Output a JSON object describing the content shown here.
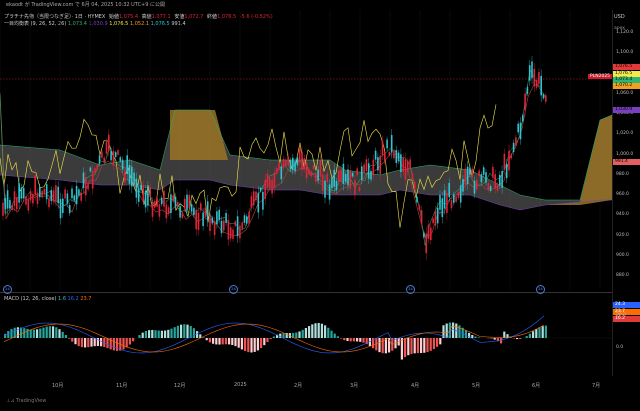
{
  "topbar": {
    "text": "ekaodt が TradingView.com で 6月 04, 2025 10:32 UTC+9 に公開"
  },
  "legend": {
    "symbol": "プラチナ先物（当限つなぎ足）· 1日 · HYMEX",
    "open_label": "始値",
    "open": "1,075.4",
    "high_label": "高値",
    "high": "1,077.1",
    "low_label": "安値",
    "low": "1,072.7",
    "close_label": "終値",
    "close": "1,076.5",
    "change": "-5.6 (-0.52%)",
    "ichimoku": "一目均衡表 (9, 26, 52, 26)",
    "ich_values": [
      "1,073.4",
      "1,030.9",
      "1,076.5",
      "1,052.1",
      "1,076.5",
      "991.4"
    ]
  },
  "price_axis": {
    "currency": "USD",
    "mode": "apex",
    "ticks": [
      "1,120.0",
      "1,100.0",
      "1,080.0",
      "1,060.0",
      "1,040.0",
      "1,020.0",
      "1,000.0",
      "980.0",
      "960.0",
      "940.0",
      "920.0",
      "900.0",
      "880.0"
    ],
    "labels": [
      {
        "text": "1,076.5",
        "color": "#e03a3a"
      },
      {
        "text": "1,076.5",
        "color": "#f4e84b"
      },
      {
        "text": "1,073.4",
        "color": "#2bb673"
      },
      {
        "text": "1,070.2",
        "color": "#f0a020"
      },
      {
        "text": "1,030.9",
        "color": "#7a3fc0"
      },
      {
        "text": "991.4",
        "color": "#e36060"
      }
    ],
    "symbol_tag": "PLN2025"
  },
  "macd": {
    "label": "MACD (12, 26, close)",
    "values": [
      "1.6",
      "16.2",
      "23.7"
    ],
    "ticks": [
      "20.0",
      "0.0"
    ],
    "labels": [
      {
        "text": "24.3",
        "color": "#2962ff"
      },
      {
        "text": "23.7",
        "color": "#ff6d00"
      },
      {
        "text": "16.2",
        "color": "#e03a3a"
      }
    ]
  },
  "time_axis": {
    "ticks": [
      "10月",
      "11月",
      "12月",
      "2025",
      "2月",
      "3月",
      "4月",
      "5月",
      "6月",
      "7月"
    ]
  },
  "footer": {
    "brand": "TradingView"
  },
  "colors": {
    "up": "#2ec4d0",
    "down": "#e0243a",
    "tenkan": "#f4e84b",
    "kijun": "#b5433a",
    "chikou": "#f4e84b",
    "spanA": "#2bb673",
    "spanB": "#7a3fc0",
    "cloud_up": "#9a7424",
    "cloud_dn": "#6b6b6b"
  }
}
